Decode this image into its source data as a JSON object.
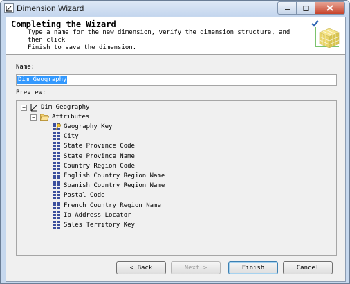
{
  "window": {
    "title": "Dimension Wizard"
  },
  "header": {
    "title": "Completing the Wizard",
    "description": "Type a name for the new dimension, verify the dimension structure, and then click\nFinish to save the dimension."
  },
  "name_section": {
    "label": "Name:",
    "value": "Dim Geography"
  },
  "preview_section": {
    "label": "Preview:",
    "dimension": "Dim Geography",
    "attributes_folder": "Attributes",
    "attributes": [
      {
        "label": "Geography Key",
        "icon": "key-attribute-icon"
      },
      {
        "label": "City",
        "icon": "attribute-icon"
      },
      {
        "label": "State Province Code",
        "icon": "attribute-icon"
      },
      {
        "label": "State Province Name",
        "icon": "attribute-icon"
      },
      {
        "label": "Country Region Code",
        "icon": "attribute-icon"
      },
      {
        "label": "English Country Region Name",
        "icon": "attribute-icon"
      },
      {
        "label": "Spanish Country Region Name",
        "icon": "attribute-icon"
      },
      {
        "label": "Postal Code",
        "icon": "attribute-icon"
      },
      {
        "label": "French Country Region Name",
        "icon": "attribute-icon"
      },
      {
        "label": "Ip Address Locator",
        "icon": "attribute-icon"
      },
      {
        "label": "Sales Territory Key",
        "icon": "attribute-icon"
      }
    ]
  },
  "buttons": {
    "back": "< Back",
    "next": "Next >",
    "finish": "Finish",
    "cancel": "Cancel"
  },
  "colors": {
    "selection": "#3399ff",
    "titlebar": "#c4d6ee",
    "close": "#c7442c"
  }
}
